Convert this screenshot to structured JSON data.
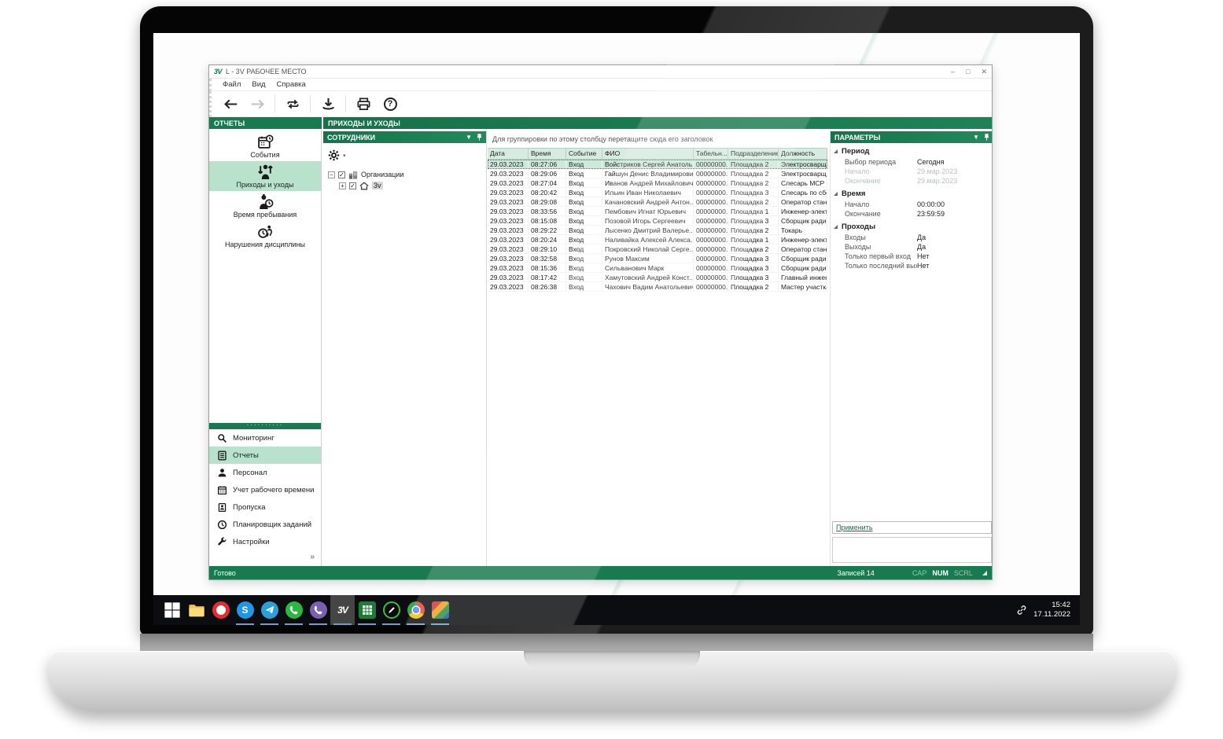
{
  "colors": {
    "accent": "#187A50",
    "selection": "#B9E2CD",
    "table_header": "#D7EBE0",
    "selected_row": "#CDE9DB",
    "taskbar": "#0C0D10"
  },
  "window": {
    "logo": "3V",
    "title": "L - 3V РАБОЧЕЕ МЕСТО",
    "menu": [
      "Файл",
      "Вид",
      "Справка"
    ],
    "controls": {
      "minimize": "–",
      "maximize": "□",
      "close": "✕"
    }
  },
  "toolbar": {
    "buttons": [
      {
        "name": "back",
        "enabled": true
      },
      {
        "name": "forward",
        "enabled": false
      },
      {
        "name": "refresh",
        "enabled": true
      },
      {
        "name": "export",
        "enabled": true
      },
      {
        "name": "print",
        "enabled": true
      },
      {
        "name": "help",
        "enabled": true
      }
    ]
  },
  "panels": {
    "reports": {
      "title": "ОТЧЕТЫ",
      "items": [
        {
          "icon": "calendar-clock",
          "label": "События",
          "selected": false
        },
        {
          "icon": "person-arrows",
          "label": "Приходы и уходы",
          "selected": true
        },
        {
          "icon": "person-clock",
          "label": "Время пребывания",
          "selected": false
        },
        {
          "icon": "clock-runner",
          "label": "Нарушения дисциплины",
          "selected": false
        }
      ]
    },
    "nav": {
      "items": [
        {
          "icon": "search",
          "label": "Мониторинг",
          "selected": false
        },
        {
          "icon": "report",
          "label": "Отчеты",
          "selected": true
        },
        {
          "icon": "person",
          "label": "Персонал",
          "selected": false
        },
        {
          "icon": "calendar",
          "label": "Учет рабочего времени",
          "selected": false
        },
        {
          "icon": "badge",
          "label": "Пропуска",
          "selected": false
        },
        {
          "icon": "clock",
          "label": "Планировщик заданий",
          "selected": false
        },
        {
          "icon": "wrench",
          "label": "Настройки",
          "selected": false
        }
      ],
      "more": "»"
    },
    "main": {
      "title": "ПРИХОДЫ И УХОДЫ"
    },
    "employees": {
      "title": "СОТРУДНИКИ",
      "tree": {
        "root": "Организации",
        "child": "3v"
      }
    },
    "parameters": {
      "title": "ПАРАМЕТРЫ",
      "groups": [
        {
          "name": "Период",
          "rows": [
            {
              "label": "Выбор периода",
              "value": "Сегодня",
              "disabled": false
            },
            {
              "label": "Начало",
              "value": "29.мар.2023",
              "disabled": true
            },
            {
              "label": "Окончание",
              "value": "29.мар.2023",
              "disabled": true
            }
          ]
        },
        {
          "name": "Время",
          "rows": [
            {
              "label": "Начало",
              "value": "00:00:00",
              "disabled": false
            },
            {
              "label": "Окончание",
              "value": "23:59:59",
              "disabled": false
            }
          ]
        },
        {
          "name": "Проходы",
          "rows": [
            {
              "label": "Входы",
              "value": "Да",
              "disabled": false
            },
            {
              "label": "Выходы",
              "value": "Да",
              "disabled": false
            },
            {
              "label": "Только первый вход",
              "value": "Нет",
              "disabled": false
            },
            {
              "label": "Только последний вых...",
              "value": "Нет",
              "disabled": false
            }
          ]
        }
      ],
      "apply": "Применить"
    }
  },
  "table": {
    "group_hint": "Для группировки по этому столбцу перетащите сюда его заголовок",
    "columns": [
      "Дата",
      "Время",
      "Событие",
      "ФИО",
      "Табельн...",
      "Подразделение",
      "Должность"
    ],
    "selected_row": 0,
    "rows": [
      [
        "29.03.2023",
        "08:27:06",
        "Вход",
        "Войстриков Сергей Анатоль...",
        "00000000...",
        "Площадка 2",
        "Электросварщ..."
      ],
      [
        "29.03.2023",
        "08:29:06",
        "Вход",
        "Гайшун Денис Владимирович",
        "00000000...",
        "Площадка 2",
        "Электросварщ..."
      ],
      [
        "29.03.2023",
        "08:27:04",
        "Вход",
        "Иванов Андрей Михайлович",
        "00000000...",
        "Площадка 2",
        "Слесарь МСР"
      ],
      [
        "29.03.2023",
        "08:20:42",
        "Вход",
        "Ильин Иван Николаевич",
        "00000000...",
        "Площадка 3",
        "Слесарь по сбо..."
      ],
      [
        "29.03.2023",
        "08:29:08",
        "Вход",
        "Качановский Андрей Антон...",
        "00000000...",
        "Площадка 2",
        "Оператор стан..."
      ],
      [
        "29.03.2023",
        "08:33:56",
        "Вход",
        "Пембович Игнат Юрьевич",
        "00000000...",
        "Площадка 1",
        "Инженер-элект..."
      ],
      [
        "29.03.2023",
        "08:15:08",
        "Вход",
        "Позовой Игорь Сергеевич",
        "00000000...",
        "Площадка 3",
        "Сборщик радио..."
      ],
      [
        "29.03.2023",
        "08:29:22",
        "Вход",
        "Лысенко Дмитрий Валерье...",
        "00000000...",
        "Площадка 2",
        "Токарь"
      ],
      [
        "29.03.2023",
        "08:20:24",
        "Вход",
        "Наливайка Алексей Алекса...",
        "00000000...",
        "Площадка 1",
        "Инженер-элект..."
      ],
      [
        "29.03.2023",
        "08:29:10",
        "Вход",
        "Покровский Николай Серге...",
        "00000000...",
        "Площадка 2",
        "Оператор стан..."
      ],
      [
        "29.03.2023",
        "08:32:58",
        "Вход",
        "Рунов Максим",
        "00000000...",
        "Площадка 3",
        "Сборщик радио..."
      ],
      [
        "29.03.2023",
        "08:15:36",
        "Вход",
        "Сильванович Марк",
        "00000000...",
        "Площадка 3",
        "Сборщик радио..."
      ],
      [
        "29.03.2023",
        "08:17:42",
        "Вход",
        "Хамутовский Андрей Конст...",
        "00000000...",
        "Площадка 3",
        "Главный инжен..."
      ],
      [
        "29.03.2023",
        "08:26:38",
        "Вход",
        "Чахович Вадим Анатольевич",
        "00000000...",
        "Площадка 2",
        "Мастер участка..."
      ]
    ]
  },
  "statusbar": {
    "ready": "Готово",
    "records": "Записей 14",
    "flags": [
      {
        "label": "CAP",
        "active": false
      },
      {
        "label": "NUM",
        "active": true
      },
      {
        "label": "SCRL",
        "active": false
      }
    ]
  },
  "taskbar": {
    "apps": [
      {
        "icon": "start",
        "running": false,
        "active": false
      },
      {
        "icon": "explorer",
        "running": false,
        "active": false
      },
      {
        "icon": "opera",
        "running": false,
        "active": false
      },
      {
        "icon": "skype",
        "running": true,
        "active": false
      },
      {
        "icon": "telegram",
        "running": true,
        "active": false
      },
      {
        "icon": "whatsapp",
        "running": true,
        "active": false
      },
      {
        "icon": "viber",
        "running": true,
        "active": false
      },
      {
        "icon": "3v",
        "running": true,
        "active": true
      },
      {
        "icon": "spreadsheet",
        "running": true,
        "active": false
      },
      {
        "icon": "drawing",
        "running": true,
        "active": false
      },
      {
        "icon": "chrome",
        "running": true,
        "active": false
      },
      {
        "icon": "media",
        "running": true,
        "active": false
      }
    ],
    "time": "15:42",
    "date": "17.11.2022"
  }
}
